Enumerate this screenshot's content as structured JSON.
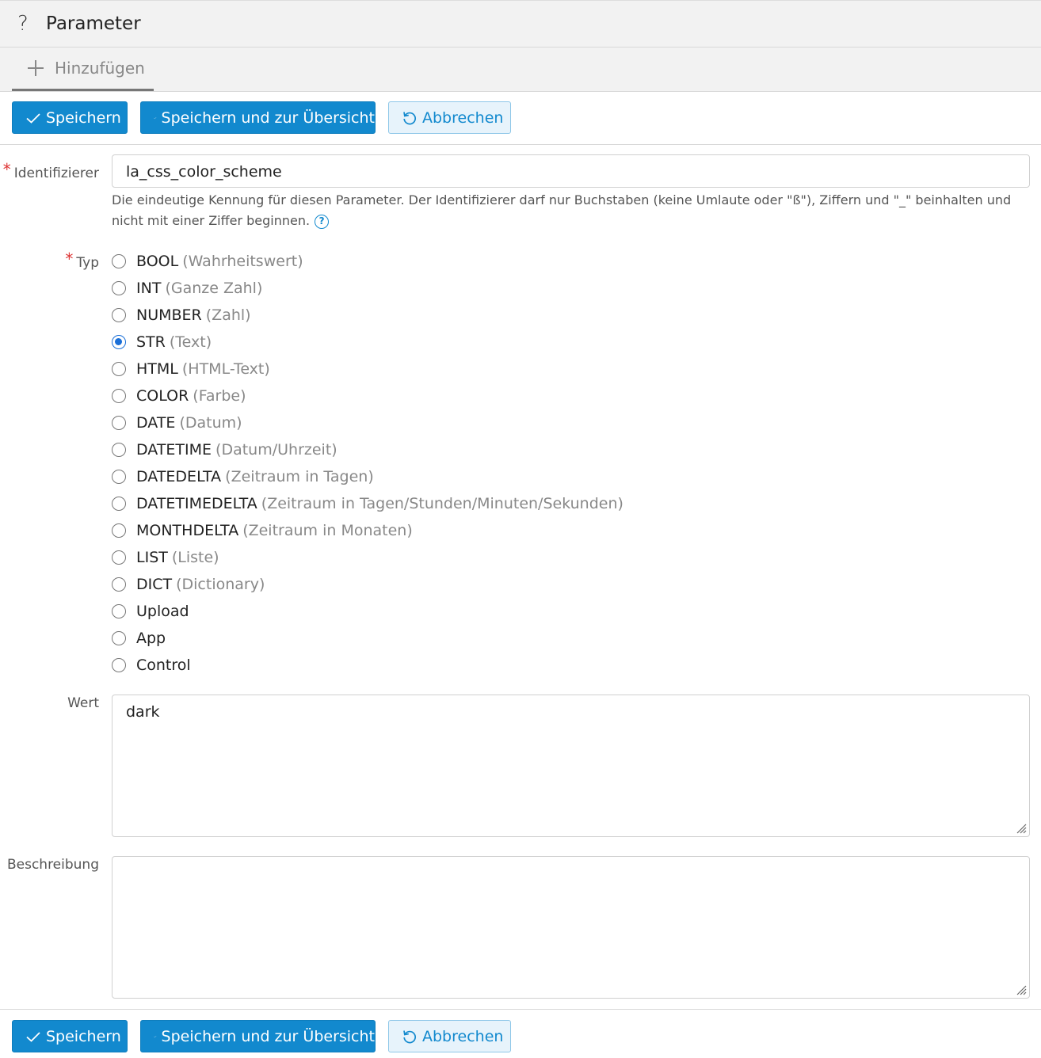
{
  "header": {
    "help_icon": "?",
    "title": "Parameter"
  },
  "tabs": [
    {
      "label": "Hinzufügen",
      "icon": "plus-icon"
    }
  ],
  "actions": {
    "save_label": "Speichern",
    "save_overview_label": "Speichern und zur Übersicht",
    "cancel_label": "Abbrechen"
  },
  "form": {
    "identifier": {
      "label": "Identifizierer",
      "value": "la_css_color_scheme",
      "help": "Die eindeutige Kennung für diesen Parameter. Der Identifizierer darf nur Buchstaben (keine Umlaute oder \"ß\"), Ziffern und \"_\" beinhalten und nicht mit einer Ziffer beginnen.",
      "help_icon": "?"
    },
    "type": {
      "label": "Typ",
      "selected": "STR",
      "options": [
        {
          "name": "BOOL",
          "desc": "(Wahrheitswert)"
        },
        {
          "name": "INT",
          "desc": "(Ganze Zahl)"
        },
        {
          "name": "NUMBER",
          "desc": "(Zahl)"
        },
        {
          "name": "STR",
          "desc": "(Text)"
        },
        {
          "name": "HTML",
          "desc": "(HTML-Text)"
        },
        {
          "name": "COLOR",
          "desc": "(Farbe)"
        },
        {
          "name": "DATE",
          "desc": "(Datum)"
        },
        {
          "name": "DATETIME",
          "desc": "(Datum/Uhrzeit)"
        },
        {
          "name": "DATEDELTA",
          "desc": "(Zeitraum in Tagen)"
        },
        {
          "name": "DATETIMEDELTA",
          "desc": "(Zeitraum in Tagen/Stunden/Minuten/Sekunden)"
        },
        {
          "name": "MONTHDELTA",
          "desc": "(Zeitraum in Monaten)"
        },
        {
          "name": "LIST",
          "desc": "(Liste)"
        },
        {
          "name": "DICT",
          "desc": "(Dictionary)"
        },
        {
          "name": "Upload",
          "desc": ""
        },
        {
          "name": "App",
          "desc": ""
        },
        {
          "name": "Control",
          "desc": ""
        }
      ]
    },
    "value": {
      "label": "Wert",
      "value": "dark"
    },
    "description": {
      "label": "Beschreibung",
      "value": ""
    }
  },
  "colors": {
    "primary": "#1289ce",
    "radio_checked": "#1a6fd8",
    "required": "#dd3333"
  }
}
